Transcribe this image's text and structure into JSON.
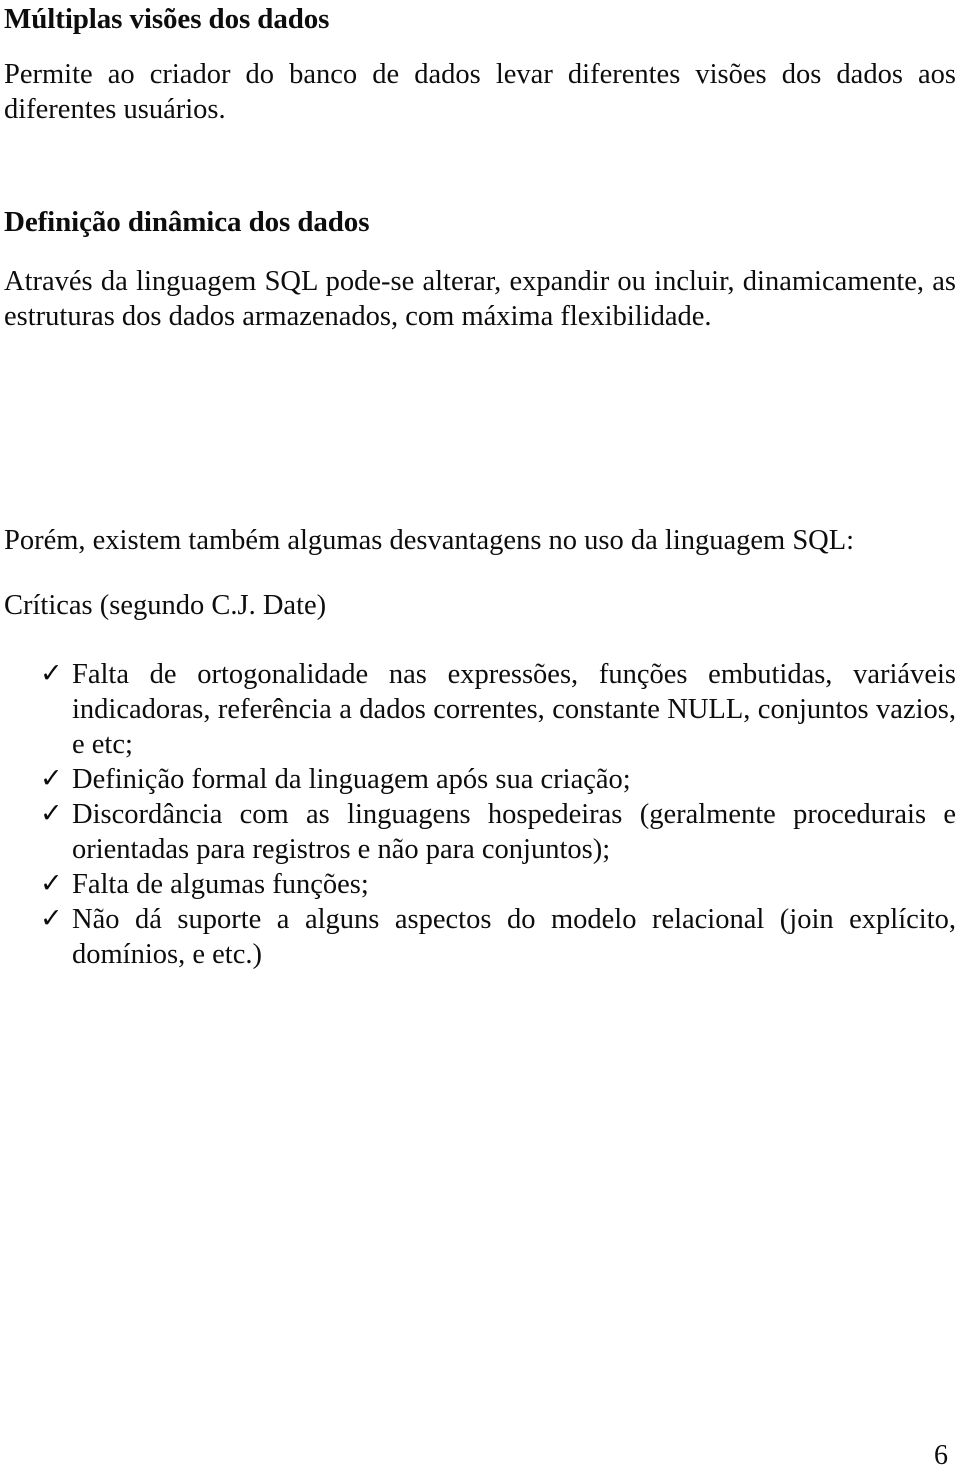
{
  "document": {
    "language": "pt-BR",
    "page_number": "6",
    "background_color": "#ffffff",
    "text_color": "#0d0d0d"
  },
  "sections": [
    {
      "heading": "Múltiplas visões dos dados",
      "paragraph": "Permite ao criador do banco de dados levar diferentes visões dos dados aos diferentes usuários."
    },
    {
      "heading": "Definição dinâmica dos dados",
      "paragraph": "Através da linguagem SQL pode-se alterar, expandir ou incluir, dinamicamente, as estruturas dos dados armazenados, com máxima flexibilidade."
    }
  ],
  "transition": {
    "intro": "Porém, existem também algumas desvantagens no uso da linguagem SQL:",
    "subtitle": "Críticas (segundo C.J. Date)"
  },
  "criticisms": {
    "bullet_glyph": "✓",
    "items": [
      "Falta de ortogonalidade nas expressões, funções embutidas, variáveis indicadoras, referência a dados correntes, constante NULL, conjuntos vazios, e etc;",
      "Definição formal da linguagem após sua criação;",
      "Discordância com as linguagens hospedeiras (geralmente procedurais e orientadas para registros e não para conjuntos);",
      "Falta de algumas funções;",
      "Não dá suporte a alguns aspectos do modelo relacional (join explícito, domínios, e etc.)"
    ]
  }
}
